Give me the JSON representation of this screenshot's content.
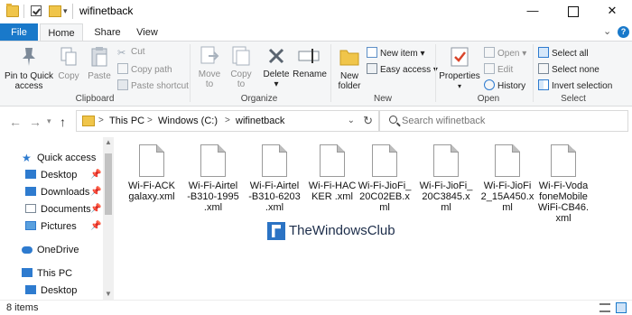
{
  "window": {
    "title": "wifinetback",
    "minimize_glyph": "—",
    "close_glyph": "✕"
  },
  "tabs": {
    "file": "File",
    "home": "Home",
    "share": "Share",
    "view": "View"
  },
  "ribbon": {
    "clipboard": {
      "label": "Clipboard",
      "pin": "Pin to Quick\naccess",
      "copy": "Copy",
      "paste": "Paste",
      "cut": "Cut",
      "copy_path": "Copy path",
      "paste_shortcut": "Paste shortcut"
    },
    "organize": {
      "label": "Organize",
      "move_to": "Move\nto",
      "copy_to": "Copy\nto",
      "delete": "Delete",
      "rename": "Rename"
    },
    "new": {
      "label": "New",
      "new_folder": "New\nfolder",
      "new_item": "New item",
      "easy_access": "Easy access"
    },
    "open": {
      "label": "Open",
      "properties": "Properties",
      "open": "Open",
      "edit": "Edit",
      "history": "History"
    },
    "select": {
      "label": "Select",
      "select_all": "Select all",
      "select_none": "Select none",
      "invert_selection": "Invert selection"
    }
  },
  "address": {
    "crumbs": [
      "This PC",
      "Windows (C:)",
      "wifinetback"
    ],
    "separator": ">",
    "search_placeholder": "Search wifinetback"
  },
  "navpane": {
    "items": [
      {
        "label": "Quick access",
        "pinned": false
      },
      {
        "label": "Desktop",
        "pinned": true
      },
      {
        "label": "Downloads",
        "pinned": true
      },
      {
        "label": "Documents",
        "pinned": true
      },
      {
        "label": "Pictures",
        "pinned": true
      },
      {
        "label": "OneDrive",
        "pinned": false
      },
      {
        "label": "This PC",
        "pinned": false
      },
      {
        "label": "Desktop",
        "pinned": false
      }
    ]
  },
  "files": [
    "Wi-Fi-ACK\ngalaxy.xml",
    "Wi-Fi-Airtel\n-B310-1995\n.xml",
    "Wi-Fi-Airtel\n-B310-6203\n.xml",
    "Wi-Fi-HAC\nKER .xml",
    "Wi-Fi-JioFi_\n20C02EB.x\nml",
    "Wi-Fi-JioFi_\n20C3845.x\nml",
    "Wi-Fi-JioFi\n2_15A450.x\nml",
    "Wi-Fi-Voda\nfoneMobile\nWiFi-CB46.\nxml"
  ],
  "watermark": "TheWindowsClub",
  "status": {
    "items": "8 items"
  },
  "colors": {
    "accent": "#1979ca",
    "ribbon_bg": "#f5f6f7",
    "folder": "#f0c54a"
  }
}
